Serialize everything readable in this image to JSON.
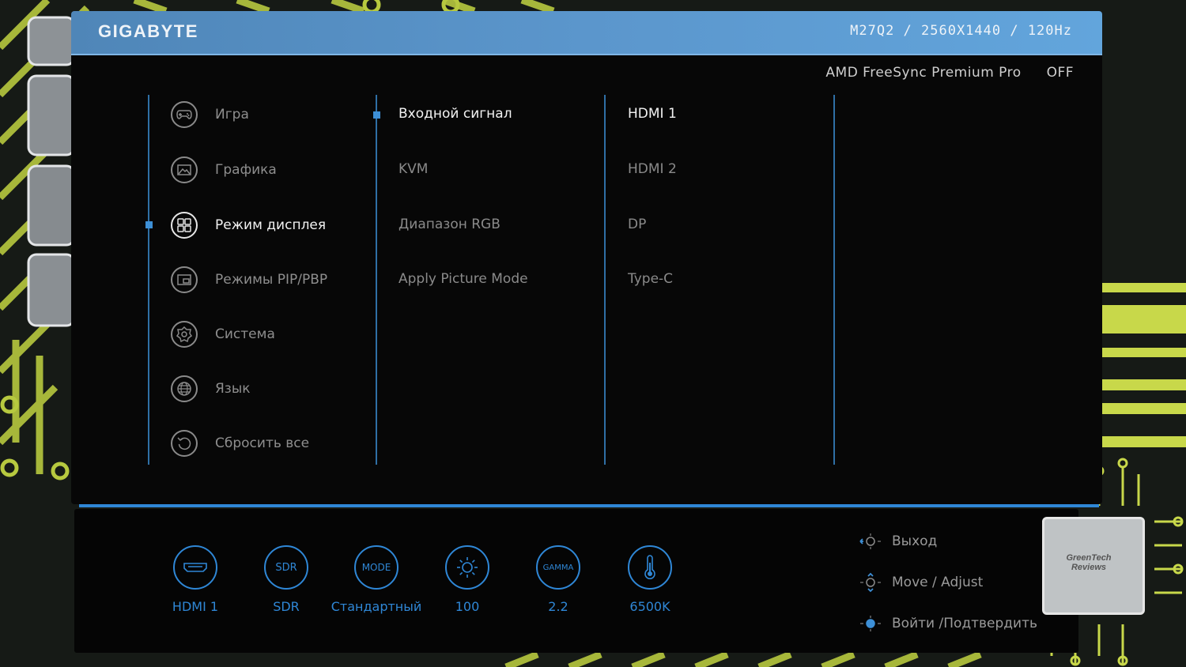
{
  "header": {
    "brand": "GIGABYTE",
    "model_info": "M27Q2 / 2560X1440 / 120Hz"
  },
  "freesync": {
    "label": "AMD FreeSync Premium Pro",
    "value": "OFF"
  },
  "main_menu": {
    "items": [
      {
        "label": "Игра",
        "icon": "gamepad-icon"
      },
      {
        "label": "Графика",
        "icon": "picture-icon"
      },
      {
        "label": "Режим дисплея",
        "icon": "display-mode-icon"
      },
      {
        "label": "Режимы PIP/PBP",
        "icon": "pip-icon"
      },
      {
        "label": "Система",
        "icon": "gear-icon"
      },
      {
        "label": "Язык",
        "icon": "globe-icon"
      },
      {
        "label": "Сбросить все",
        "icon": "reset-icon"
      }
    ],
    "selected": "Режим дисплея"
  },
  "submenu": {
    "items": [
      "Входной сигнал",
      "KVM",
      "Диапазон RGB",
      "Apply Picture Mode"
    ],
    "selected": "Входной сигнал"
  },
  "options": {
    "items": [
      "HDMI 1",
      "HDMI 2",
      "DP",
      "Type-C"
    ],
    "selected": "HDMI 1"
  },
  "status_bar": [
    {
      "icon": "hdmi-icon",
      "label": "HDMI 1"
    },
    {
      "icon": "sdr-icon",
      "icon_text": "SDR",
      "label": "SDR"
    },
    {
      "icon": "mode-icon",
      "icon_text": "MODE",
      "label": "Стандартный"
    },
    {
      "icon": "brightness-icon",
      "label": "100"
    },
    {
      "icon": "gamma-icon",
      "icon_text": "GAMMA",
      "label": "2.2"
    },
    {
      "icon": "thermometer-icon",
      "label": "6500K"
    }
  ],
  "nav_hints": [
    {
      "icon": "joystick-left-icon",
      "label": "Выход"
    },
    {
      "icon": "joystick-updown-icon",
      "label": "Move / Adjust"
    },
    {
      "icon": "joystick-press-icon",
      "label": "Войти /Подтвердить"
    }
  ],
  "watermark": {
    "text": "GreenTech Reviews"
  },
  "colors": {
    "accent_blue": "#2f87d6",
    "header_blue": "#5b96cc",
    "circuit_green": "#c8d84a",
    "osd_background": "#070707"
  }
}
